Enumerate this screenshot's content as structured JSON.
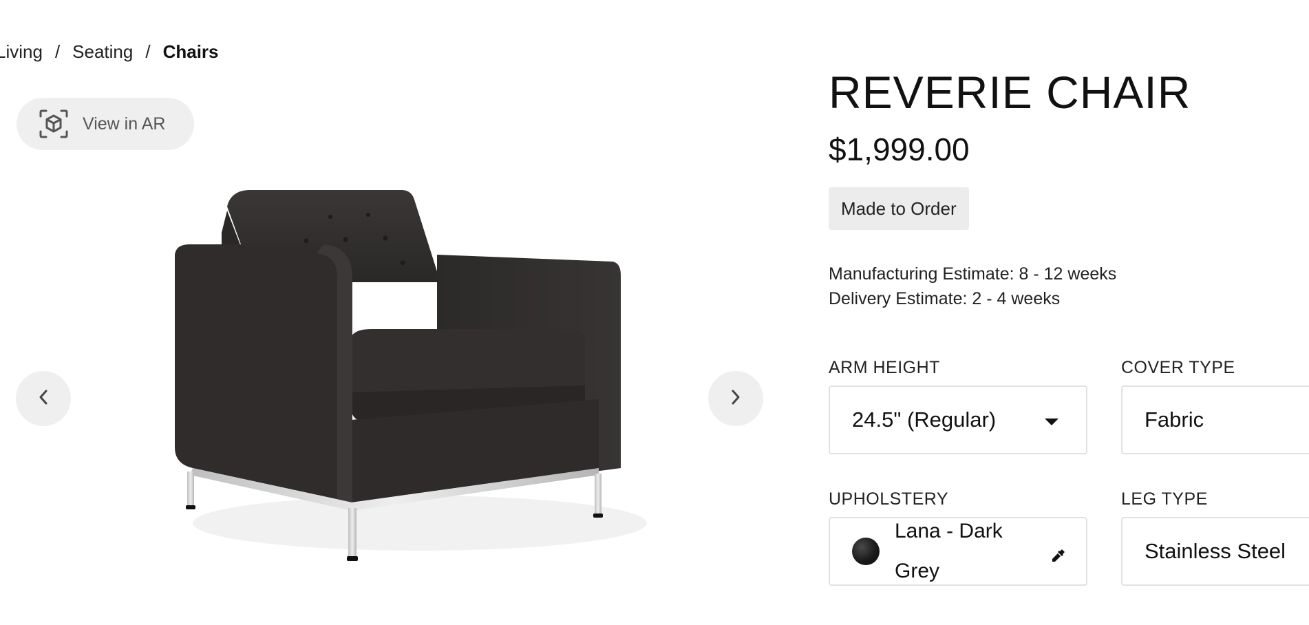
{
  "breadcrumb": {
    "items": [
      {
        "label": "Living"
      },
      {
        "label": "Seating"
      },
      {
        "label": "Chairs"
      }
    ],
    "separator": "/"
  },
  "ar_button": {
    "label": "View in AR",
    "icon": "ar-cube-icon"
  },
  "gallery": {
    "prev_icon": "chevron-left-icon",
    "next_icon": "chevron-right-icon",
    "image": "dark-grey-armchair-with-steel-legs"
  },
  "product": {
    "title": "REVERIE CHAIR",
    "price": "$1,999.00",
    "badge": "Made to Order",
    "manufacturing_estimate": "Manufacturing Estimate: 8 - 12 weeks",
    "delivery_estimate": "Delivery Estimate: 2 - 4 weeks"
  },
  "options": {
    "arm_height": {
      "label": "ARM HEIGHT",
      "value": "24.5\" (Regular)"
    },
    "cover_type": {
      "label": "COVER TYPE",
      "value": "Fabric"
    },
    "upholstery": {
      "label": "UPHOLSTERY",
      "value_line1": "Lana - Dark",
      "value_line2": "Grey",
      "swatch_color": "#1c1c1c",
      "picker_icon": "eyedropper-icon"
    },
    "leg_type": {
      "label": "LEG TYPE",
      "value": "Stainless Steel"
    }
  }
}
